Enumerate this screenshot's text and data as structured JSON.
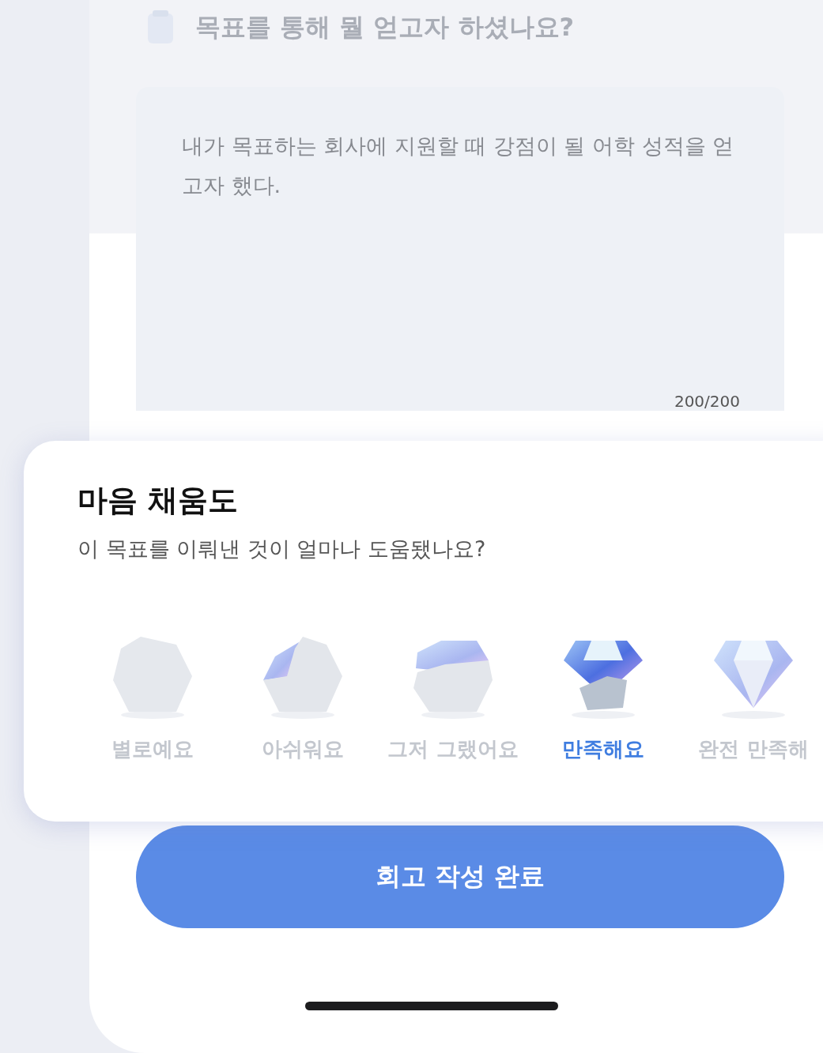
{
  "question": {
    "title": "목표를 통해 뭘 얻고자 하셨나요?"
  },
  "answer": {
    "value": "내가 목표하는 회사에 지원할 때 강점이 될 어학 성적을 얻고자 했다.",
    "counter": "200/200"
  },
  "rating_card": {
    "title": "마음 채움도",
    "subtitle": "이 목표를 이뤄낸 것이 얼마나 도움됐나요?",
    "options": [
      {
        "label": "별로예요",
        "kind": "stone",
        "selected": false
      },
      {
        "label": "아쉬워요",
        "kind": "chipped",
        "selected": false
      },
      {
        "label": "그저 그랬어요",
        "kind": "half",
        "selected": false
      },
      {
        "label": "만족해요",
        "kind": "mostly",
        "selected": true
      },
      {
        "label": "완전 만족해",
        "kind": "diamond",
        "selected": false
      }
    ]
  },
  "submit_button": "회고 작성 완료"
}
